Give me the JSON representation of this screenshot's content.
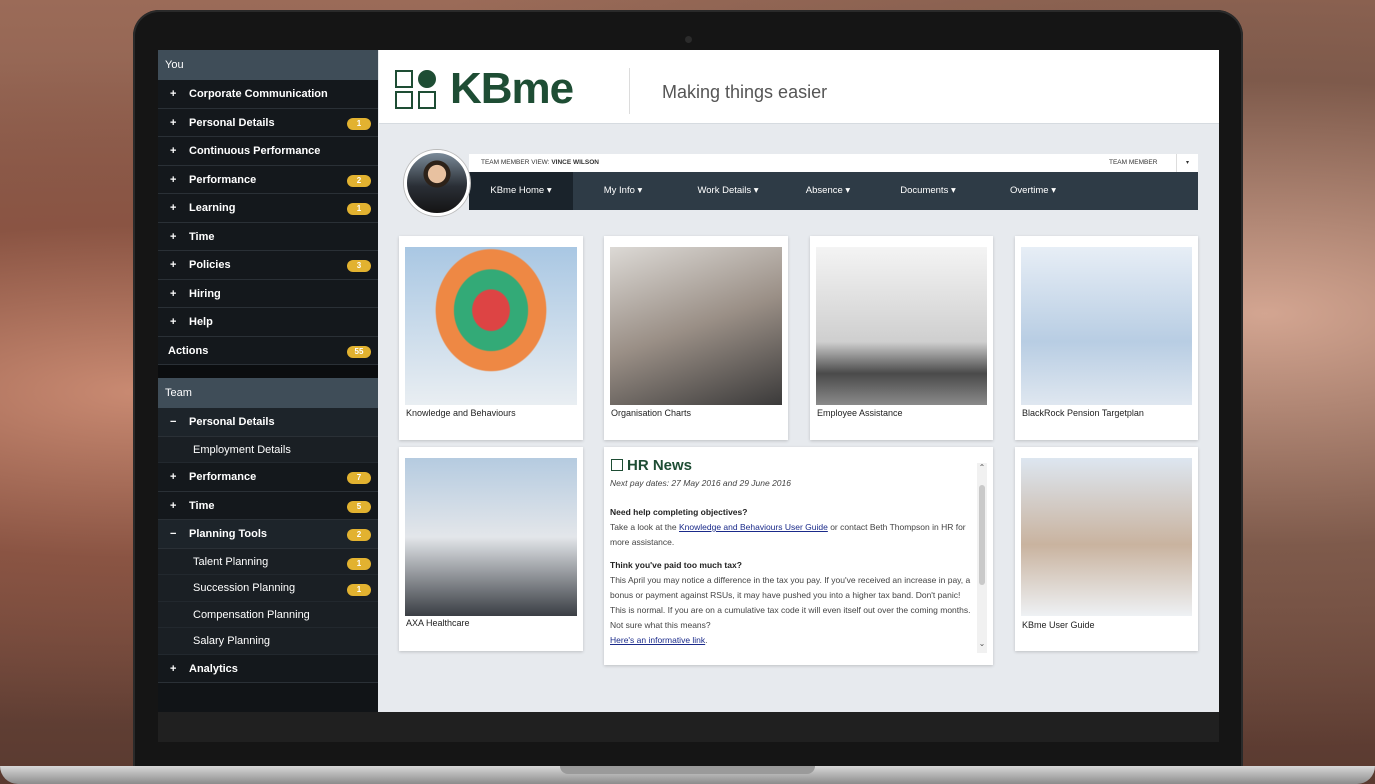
{
  "sidebar": {
    "you_title": "You",
    "you_items": [
      {
        "pm": "+",
        "label": "Corporate Communication",
        "badge": ""
      },
      {
        "pm": "+",
        "label": "Personal Details",
        "badge": "1"
      },
      {
        "pm": "+",
        "label": "Continuous Performance",
        "badge": ""
      },
      {
        "pm": "+",
        "label": "Performance",
        "badge": "2"
      },
      {
        "pm": "+",
        "label": "Learning",
        "badge": "1"
      },
      {
        "pm": "+",
        "label": "Time",
        "badge": ""
      },
      {
        "pm": "+",
        "label": "Policies",
        "badge": "3"
      },
      {
        "pm": "+",
        "label": "Hiring",
        "badge": ""
      },
      {
        "pm": "+",
        "label": "Help",
        "badge": ""
      }
    ],
    "actions": {
      "label": "Actions",
      "badge": "55"
    },
    "team_title": "Team",
    "team": {
      "personal_details": {
        "pm": "−",
        "label": "Personal Details"
      },
      "employment_details": "Employment Details",
      "performance": {
        "pm": "+",
        "label": "Performance",
        "badge": "7"
      },
      "time": {
        "pm": "+",
        "label": "Time",
        "badge": "5"
      },
      "planning_tools": {
        "pm": "−",
        "label": "Planning Tools",
        "badge": "2"
      },
      "planning_sub": [
        {
          "label": "Talent Planning",
          "badge": "1"
        },
        {
          "label": "Succession Planning",
          "badge": "1"
        },
        {
          "label": "Compensation Planning",
          "badge": ""
        },
        {
          "label": "Salary Planning",
          "badge": ""
        }
      ],
      "analytics": {
        "pm": "+",
        "label": "Analytics"
      }
    }
  },
  "header": {
    "brand": "KBme",
    "tagline": "Making things easier"
  },
  "team_member_bar": {
    "view_label": "TEAM MEMBER VIEW:",
    "view_name": "VINCE WILSON",
    "role": "TEAM MEMBER",
    "dropdown": "▾"
  },
  "nav": [
    {
      "label": "KBme Home ▾"
    },
    {
      "label": "My Info ▾"
    },
    {
      "label": "Work Details ▾"
    },
    {
      "label": "Absence ▾"
    },
    {
      "label": "Documents ▾"
    },
    {
      "label": "Overtime ▾"
    }
  ],
  "tiles": [
    "Knowledge and Behaviours",
    "Organisation Charts",
    "Employee Assistance",
    "BlackRock Pension Targetplan",
    "AXA Healthcare",
    "KBme User Guide"
  ],
  "news": {
    "title": "HR News",
    "pay_dates": "Next pay dates: 27 May 2016 and 29 June 2016",
    "q1": "Need help completing objectives?",
    "q1_pre": "Take a look at the ",
    "q1_link": "Knowledge and Behaviours User Guide",
    "q1_post": " or contact Beth Thompson in HR for more assistance.",
    "q2": "Think you've paid too much tax?",
    "q2_text": "This April you may notice a difference in the tax you pay. If you've received an increase in pay, a bonus or payment against RSUs, it may have pushed you into a higher tax band. Don't panic! This is normal. If you are on a cumulative tax code it will even itself out over the coming months. Not sure what this means?",
    "q2_link": "Here's an informative link",
    "q2_end": "."
  },
  "icons": {
    "scroll_up": "⌃",
    "scroll_down": "⌄"
  }
}
